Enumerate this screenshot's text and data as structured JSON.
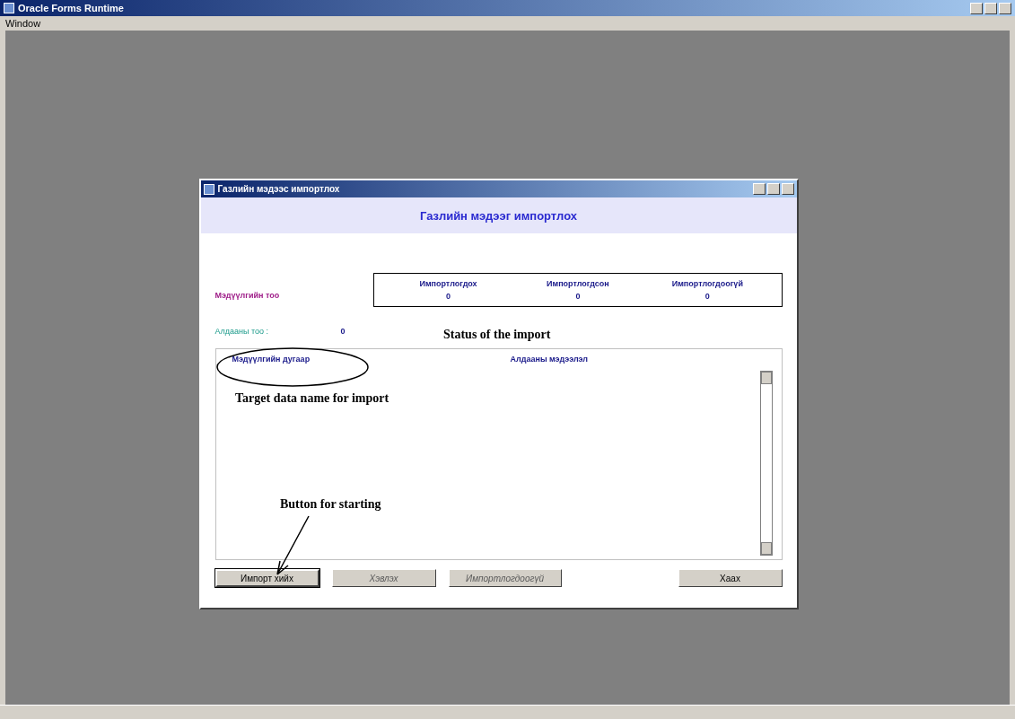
{
  "window": {
    "title": "Oracle Forms Runtime",
    "menu": [
      "Window"
    ]
  },
  "dialog": {
    "title": "Газлийн мэдээс импортлох",
    "heading": "Газлийн мэдээг импортлох",
    "count_label": "Мэдүүлгийн тоо",
    "status_columns": [
      {
        "label": "Импортлогдох",
        "value": "0"
      },
      {
        "label": "Импортлогдсон",
        "value": "0"
      },
      {
        "label": "Импортлогдоогүй",
        "value": "0"
      }
    ],
    "error_label": "Алдааны тоо :",
    "error_value": "0",
    "list_columns": [
      "Мэдүүлгийн дугаар",
      "Алдааны мэдээлэл"
    ],
    "buttons": [
      {
        "label": "Импорт хийх",
        "disabled": false,
        "focused": true
      },
      {
        "label": "Хэвлэх",
        "disabled": true,
        "focused": false
      },
      {
        "label": "Импортлогдоогүй",
        "disabled": true,
        "focused": false
      },
      {
        "label": "Хаах",
        "disabled": false,
        "focused": false
      }
    ]
  },
  "annotations": {
    "status": "Status of the import",
    "target": "Target data name for import",
    "button": "Button for starting"
  }
}
